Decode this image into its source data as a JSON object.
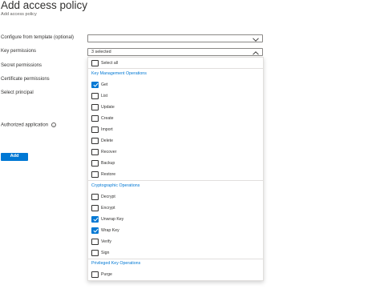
{
  "header": {
    "title": "Add access policy",
    "subtitle": "Add access policy"
  },
  "form": {
    "configure_label": "Configure from template (optional)",
    "configure_value": "",
    "key_permissions_label": "Key permissions",
    "key_permissions_value": "3 selected",
    "secret_permissions_label": "Secret permissions",
    "certificate_permissions_label": "Certificate permissions",
    "select_principal_label": "Select principal",
    "authorized_application_label": "Authorized application",
    "add_button_label": "Add"
  },
  "dropdown_panel": {
    "select_all_label": "Select all",
    "groups": [
      {
        "heading": "Key Management Operations",
        "options": [
          {
            "label": "Get",
            "checked": true
          },
          {
            "label": "List",
            "checked": false
          },
          {
            "label": "Update",
            "checked": false
          },
          {
            "label": "Create",
            "checked": false
          },
          {
            "label": "Import",
            "checked": false
          },
          {
            "label": "Delete",
            "checked": false
          },
          {
            "label": "Recover",
            "checked": false
          },
          {
            "label": "Backup",
            "checked": false
          },
          {
            "label": "Restore",
            "checked": false
          }
        ]
      },
      {
        "heading": "Cryptographic Operations",
        "options": [
          {
            "label": "Decrypt",
            "checked": false
          },
          {
            "label": "Encrypt",
            "checked": false
          },
          {
            "label": "Unwrap Key",
            "checked": true
          },
          {
            "label": "Wrap Key",
            "checked": true
          },
          {
            "label": "Verify",
            "checked": false
          },
          {
            "label": "Sign",
            "checked": false
          }
        ]
      },
      {
        "heading": "Privileged Key Operations",
        "options": [
          {
            "label": "Purge",
            "checked": false
          }
        ]
      }
    ]
  },
  "icons": {
    "info": "info-icon",
    "chevron_down": "chevron-down-icon",
    "chevron_up": "chevron-up-icon",
    "checkmark": "checkmark-icon"
  },
  "colors": {
    "accent": "#0078d4",
    "text": "#323130",
    "border": "#8a8886"
  }
}
